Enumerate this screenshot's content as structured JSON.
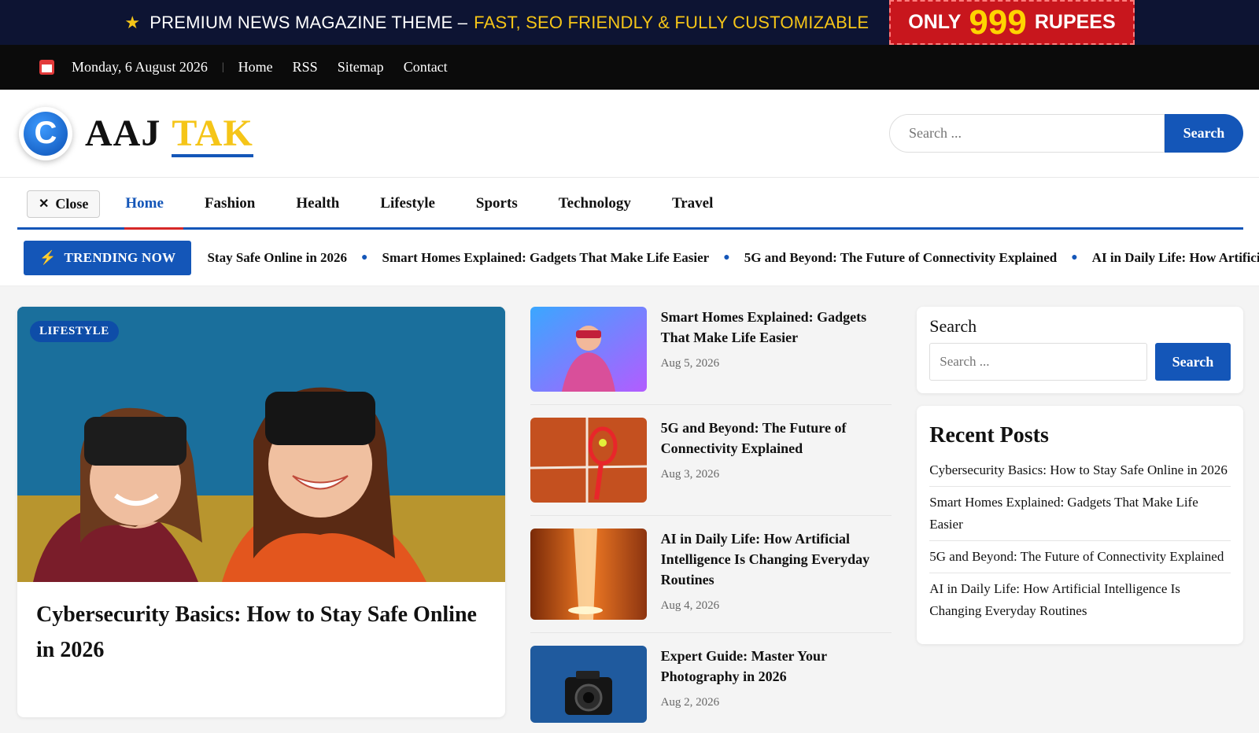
{
  "promo": {
    "text": "PREMIUM NEWS MAGAZINE THEME –",
    "highlight": "FAST, SEO FRIENDLY & FULLY CUSTOMIZABLE",
    "badge_pre": "ONLY",
    "badge_price": "999",
    "badge_post": "RUPEES"
  },
  "topnav": {
    "date": "Monday, 6 August 2026",
    "links": [
      "Home",
      "RSS",
      "Sitemap",
      "Contact"
    ]
  },
  "header": {
    "logo_letter": "C",
    "brand_part1": "AAJ",
    "brand_part2": "TAK",
    "search_placeholder": "Search ...",
    "search_button": "Search"
  },
  "menu": {
    "close_label": "Close",
    "items": [
      "Home",
      "Fashion",
      "Health",
      "Lifestyle",
      "Sports",
      "Technology",
      "Travel"
    ],
    "active": "Home"
  },
  "trending": {
    "label": "TRENDING NOW",
    "items": [
      "Stay Safe Online in 2026",
      "Smart Homes Explained: Gadgets That Make Life Easier",
      "5G and Beyond: The Future of Connectivity Explained",
      "AI in Daily Life: How Artificial Intelligence Is Changing Everyday Routines"
    ]
  },
  "feature": {
    "category": "LIFESTYLE",
    "title": "Cybersecurity Basics: How to Stay Safe Online in 2026"
  },
  "posts": [
    {
      "title": "Smart Homes Explained: Gadgets That Make Life Easier",
      "date": "Aug 5, 2026"
    },
    {
      "title": "5G and Beyond: The Future of Connectivity Explained",
      "date": "Aug 3, 2026"
    },
    {
      "title": "AI in Daily Life: How Artificial Intelligence Is Changing Everyday Routines",
      "date": "Aug 4, 2026"
    },
    {
      "title": "Expert Guide: Master Your Photography in 2026",
      "date": "Aug 2, 2026"
    }
  ],
  "sidebar": {
    "search_label": "Search",
    "search_placeholder": "Search ...",
    "search_button": "Search",
    "recent_title": "Recent Posts",
    "recent": [
      "Cybersecurity Basics: How to Stay Safe Online in 2026",
      "Smart Homes Explained: Gadgets That Make Life Easier",
      "5G and Beyond: The Future of Connectivity Explained",
      "AI in Daily Life: How Artificial Intelligence Is Changing Everyday Routines"
    ]
  },
  "colors": {
    "accent": "#1456b8",
    "promo_bg": "#0d1433",
    "promo_highlight": "#f5c518",
    "badge_red": "#c8161d"
  }
}
